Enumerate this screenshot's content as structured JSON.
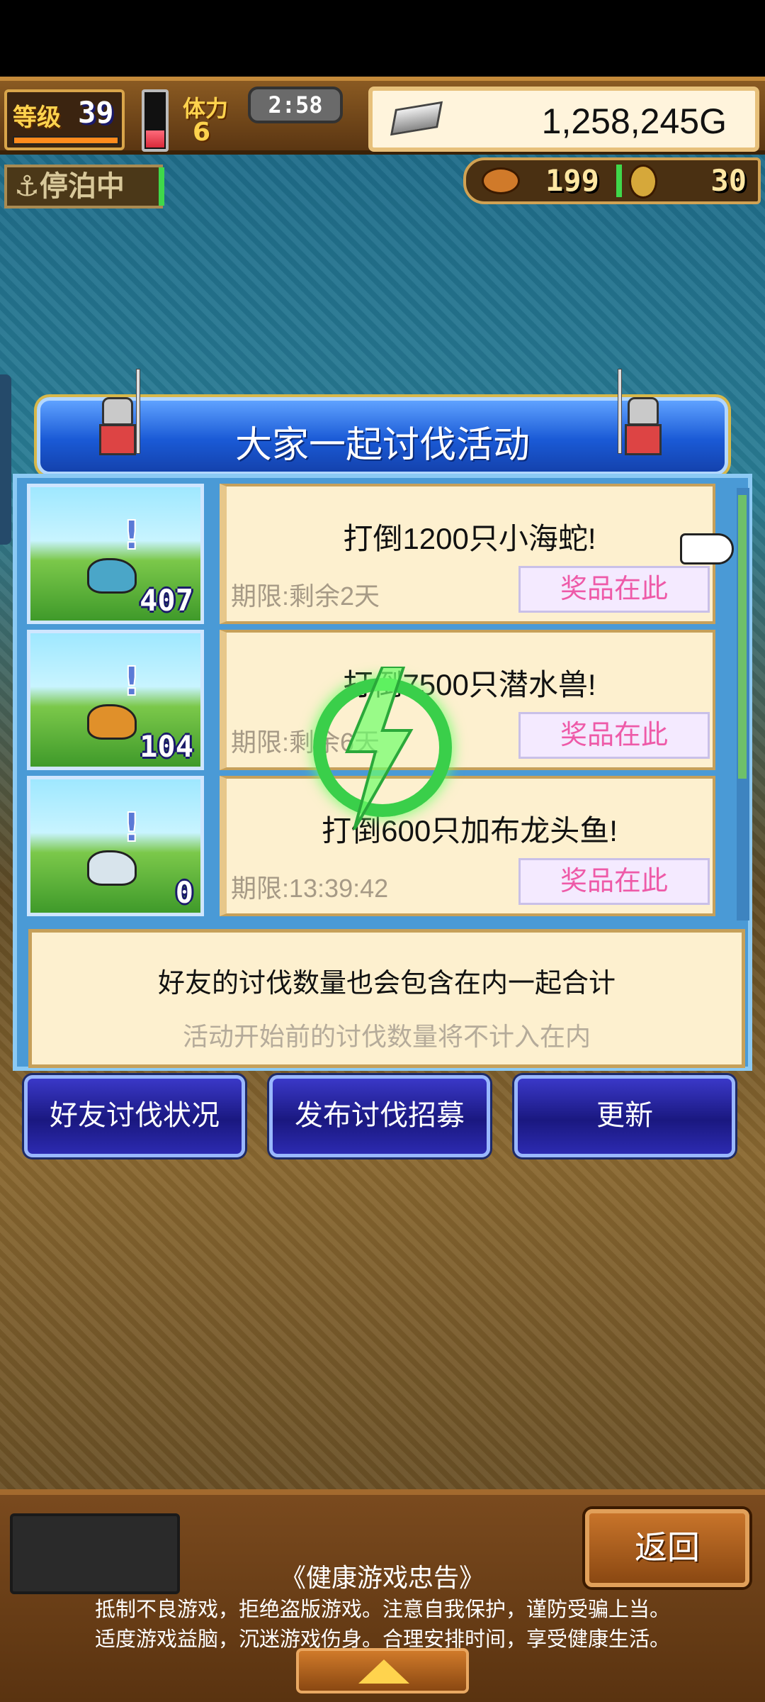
{
  "status": {
    "level_label": "等级",
    "level": "39",
    "stamina_label": "体力",
    "stamina": "6",
    "timer": "2:58",
    "gold": "1,258,245G",
    "dock_status": "停泊中",
    "resource1": "199",
    "resource2": "30"
  },
  "dialog": {
    "title": "大家一起讨伐活动",
    "quests": [
      {
        "title": "打倒1200只小海蛇!",
        "deadline": "期限:剩余2天",
        "reward": "奖品在此",
        "count": "407"
      },
      {
        "title": "打倒7500只潜水兽!",
        "deadline": "期限:剩余6天",
        "reward": "奖品在此",
        "count": "104"
      },
      {
        "title": "打倒600只加布龙头鱼!",
        "deadline": "期限:13:39:42",
        "reward": "奖品在此",
        "count": "0"
      }
    ],
    "info_main": "好友的讨伐数量也会包含在内一起合计",
    "info_sub": "活动开始前的讨伐数量将不计入在内"
  },
  "buttons": {
    "friend_status": "好友讨伐状况",
    "publish_recruit": "发布讨伐招募",
    "refresh": "更新",
    "back": "返回"
  },
  "footer": {
    "title": "《健康游戏忠告》",
    "line1": "抵制不良游戏，拒绝盗版游戏。注意自我保护，谨防受骗上当。",
    "line2": "适度游戏益脑，沉迷游戏伤身。合理安排时间，享受健康生活。"
  },
  "colors": {
    "dialog_blue": "#1a5ad6",
    "card_bg": "#fdf0cf",
    "reward_text": "#ee5aa8",
    "loading_green": "#3acf4a"
  },
  "icons": [
    "anchor-icon",
    "silver-bar-icon",
    "meat-icon",
    "coin-icon",
    "pointing-hand-icon",
    "lightning-icon",
    "up-arrow-icon"
  ]
}
